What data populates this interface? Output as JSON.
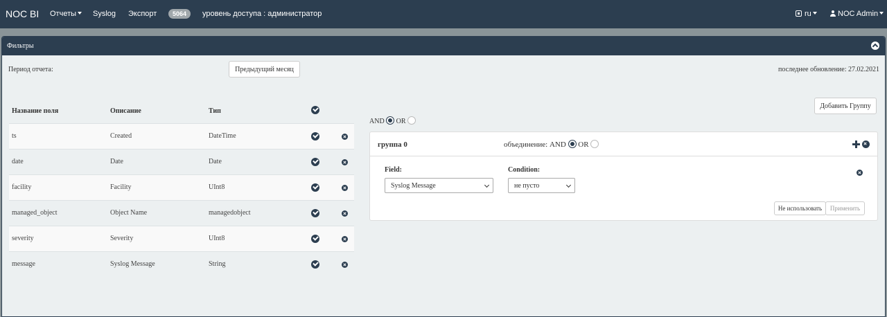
{
  "navbar": {
    "brand": "NOC BI",
    "reports": "Отчеты",
    "syslog": "Syslog",
    "export": "Экспорт",
    "badge": "5064",
    "access": "уровень доступа : администратор",
    "lang": "ru",
    "user": "NOC Admin"
  },
  "panel": {
    "title": "Фильтры",
    "period_label": "Период отчета:",
    "period_button": "Предыдущий месяц",
    "last_update": "последнее обновление: 27.02.2021"
  },
  "table": {
    "headers": [
      "Название поля",
      "Описание",
      "Тип"
    ],
    "rows": [
      {
        "name": "ts",
        "desc": "Created",
        "type": "DateTime"
      },
      {
        "name": "date",
        "desc": "Date",
        "type": "Date"
      },
      {
        "name": "facility",
        "desc": "Facility",
        "type": "UInt8"
      },
      {
        "name": "managed_object",
        "desc": "Object Name",
        "type": "managedobject"
      },
      {
        "name": "severity",
        "desc": "Severity",
        "type": "UInt8"
      },
      {
        "name": "message",
        "desc": "Syslog Message",
        "type": "String"
      }
    ]
  },
  "filters": {
    "add_group": "Добавить Группу",
    "and_label": "AND",
    "or_label": "OR",
    "group_title": "группа 0",
    "union_label": "объединение: AND",
    "union_or": "OR",
    "field_label": "Field:",
    "field_value": "Syslog Message",
    "condition_label": "Condition:",
    "condition_value": "не пусто",
    "unuse_button": "Не использовать",
    "apply_button": "Применить"
  }
}
